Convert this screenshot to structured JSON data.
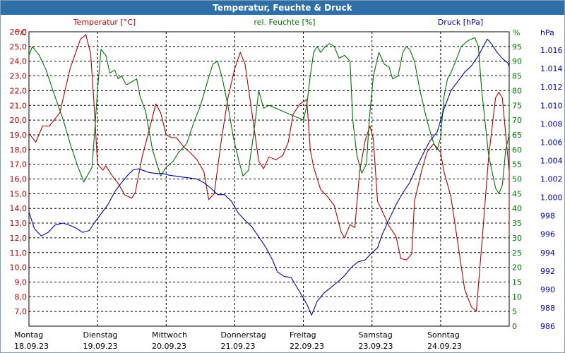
{
  "chart_data": {
    "type": "line",
    "title": "Temperatur, Feuchte & Druck",
    "series_labels": {
      "temperature": "Temperatur [°C]",
      "humidity": "rel. Feuchte [%]",
      "pressure": "Druck [hPa]"
    },
    "units": {
      "left": "°C",
      "mid": "%",
      "right": "hPa"
    },
    "colors": {
      "temperature": "#b00000",
      "humidity": "#007000",
      "pressure": "#0000a0",
      "grid": "#000000",
      "title_bar": "#2f6fa8"
    },
    "grid": true,
    "x_range": [
      0,
      7
    ],
    "x_labels": [
      {
        "day": "Montag",
        "date": "18.09.23"
      },
      {
        "day": "Dienstag",
        "date": "19.09.23"
      },
      {
        "day": "Mittwoch",
        "date": "20.09.23"
      },
      {
        "day": "Donnerstag",
        "date": "21.09.23"
      },
      {
        "day": "Freitag",
        "date": "22.09.23"
      },
      {
        "day": "Samstag",
        "date": "23.09.23"
      },
      {
        "day": "Sonntag",
        "date": "24.09.23"
      }
    ],
    "axes": {
      "temperature": {
        "min": 6.0,
        "max": 26.0,
        "ticks": [
          "26,0",
          "25,0",
          "24,0",
          "23,0",
          "22,0",
          "21,0",
          "20,0",
          "19,0",
          "18,0",
          "17,0",
          "16,0",
          "15,0",
          "14,0",
          "13,0",
          "12,0",
          "11,0",
          "10,0",
          "9,0",
          "8,0",
          "7,0"
        ]
      },
      "humidity": {
        "min": 0,
        "max": 100,
        "ticks": [
          "95",
          "90",
          "85",
          "80",
          "75",
          "70",
          "65",
          "60",
          "55",
          "50",
          "45",
          "40",
          "35",
          "30",
          "25",
          "20",
          "15",
          "10",
          "5",
          "0"
        ]
      },
      "pressure": {
        "min": 986,
        "max": 1018,
        "ticks": [
          "1.016",
          "1.014",
          "1.012",
          "1.010",
          "1.008",
          "1.006",
          "1.004",
          "1.002",
          "1.000",
          "998",
          "996",
          "994",
          "992",
          "990",
          "988",
          "986"
        ]
      }
    },
    "series": [
      {
        "name": "Temperatur [°C]",
        "axis": "temperature",
        "points": [
          [
            0.0,
            19.1
          ],
          [
            0.1,
            18.5
          ],
          [
            0.2,
            19.6
          ],
          [
            0.3,
            19.6
          ],
          [
            0.45,
            20.5
          ],
          [
            0.6,
            23.5
          ],
          [
            0.75,
            25.5
          ],
          [
            0.83,
            25.8
          ],
          [
            0.9,
            24.5
          ],
          [
            0.95,
            21
          ],
          [
            1.0,
            17
          ],
          [
            1.08,
            16.6
          ],
          [
            1.12,
            16.9
          ],
          [
            1.2,
            16.3
          ],
          [
            1.3,
            15.7
          ],
          [
            1.4,
            14.9
          ],
          [
            1.5,
            14.7
          ],
          [
            1.55,
            15.1
          ],
          [
            1.65,
            17.5
          ],
          [
            1.75,
            19.3
          ],
          [
            1.85,
            21.1
          ],
          [
            1.92,
            20.5
          ],
          [
            2.0,
            19
          ],
          [
            2.08,
            18.8
          ],
          [
            2.15,
            18.8
          ],
          [
            2.25,
            18.2
          ],
          [
            2.35,
            17.8
          ],
          [
            2.45,
            17.3
          ],
          [
            2.55,
            16.5
          ],
          [
            2.62,
            14.6
          ],
          [
            2.7,
            15
          ],
          [
            2.8,
            18.5
          ],
          [
            2.9,
            21.5
          ],
          [
            3.0,
            23.5
          ],
          [
            3.08,
            24.6
          ],
          [
            3.15,
            23.8
          ],
          [
            3.25,
            20.5
          ],
          [
            3.35,
            17.2
          ],
          [
            3.42,
            16.7
          ],
          [
            3.5,
            17.5
          ],
          [
            3.6,
            17.3
          ],
          [
            3.7,
            17.6
          ],
          [
            3.78,
            18.5
          ],
          [
            3.85,
            20.4
          ],
          [
            3.95,
            21.1
          ],
          [
            4.05,
            21.4
          ],
          [
            4.1,
            18
          ],
          [
            4.15,
            16.8
          ],
          [
            4.25,
            15.3
          ],
          [
            4.35,
            14.8
          ],
          [
            4.45,
            14.2
          ],
          [
            4.55,
            12.4
          ],
          [
            4.6,
            12
          ],
          [
            4.68,
            12.9
          ],
          [
            4.75,
            12.7
          ],
          [
            4.82,
            16.5
          ],
          [
            4.9,
            18.6
          ],
          [
            4.97,
            19.6
          ],
          [
            5.02,
            18.7
          ],
          [
            5.08,
            14.5
          ],
          [
            5.15,
            13.8
          ],
          [
            5.25,
            12.8
          ],
          [
            5.35,
            12.1
          ],
          [
            5.42,
            10.6
          ],
          [
            5.5,
            10.5
          ],
          [
            5.58,
            10.9
          ],
          [
            5.62,
            14.5
          ],
          [
            5.72,
            16.5
          ],
          [
            5.8,
            17.8
          ],
          [
            5.9,
            18.4
          ],
          [
            6.0,
            17.8
          ],
          [
            6.05,
            16.5
          ],
          [
            6.15,
            14.8
          ],
          [
            6.25,
            11.7
          ],
          [
            6.35,
            8.5
          ],
          [
            6.45,
            7.3
          ],
          [
            6.52,
            7.0
          ],
          [
            6.6,
            11.5
          ],
          [
            6.7,
            17.5
          ],
          [
            6.8,
            21.5
          ],
          [
            6.85,
            21.9
          ],
          [
            6.9,
            21.5
          ],
          [
            6.95,
            19
          ],
          [
            7.0,
            16.5
          ],
          [
            7.05,
            15.5
          ],
          [
            7.12,
            14.2
          ],
          [
            7.2,
            12.2
          ]
        ]
      },
      {
        "name": "rel. Feuchte [%]",
        "axis": "humidity",
        "points": [
          [
            0.0,
            92
          ],
          [
            0.05,
            95
          ],
          [
            0.15,
            92
          ],
          [
            0.25,
            87
          ],
          [
            0.35,
            80
          ],
          [
            0.5,
            70
          ],
          [
            0.6,
            62
          ],
          [
            0.7,
            55
          ],
          [
            0.8,
            49
          ],
          [
            0.92,
            54
          ],
          [
            1.0,
            80
          ],
          [
            1.05,
            94
          ],
          [
            1.12,
            92
          ],
          [
            1.18,
            86
          ],
          [
            1.25,
            87
          ],
          [
            1.3,
            84
          ],
          [
            1.35,
            85
          ],
          [
            1.42,
            82
          ],
          [
            1.5,
            83
          ],
          [
            1.57,
            84
          ],
          [
            1.62,
            78
          ],
          [
            1.7,
            73
          ],
          [
            1.8,
            60
          ],
          [
            1.92,
            51
          ],
          [
            2.0,
            54
          ],
          [
            2.1,
            56
          ],
          [
            2.18,
            59
          ],
          [
            2.3,
            62
          ],
          [
            2.4,
            69
          ],
          [
            2.5,
            75
          ],
          [
            2.6,
            83
          ],
          [
            2.68,
            89
          ],
          [
            2.75,
            90
          ],
          [
            2.82,
            84
          ],
          [
            2.9,
            75
          ],
          [
            2.98,
            64
          ],
          [
            3.05,
            57
          ],
          [
            3.12,
            51
          ],
          [
            3.2,
            53
          ],
          [
            3.28,
            66
          ],
          [
            3.35,
            80
          ],
          [
            3.42,
            74
          ],
          [
            3.5,
            75
          ],
          [
            3.6,
            74
          ],
          [
            3.7,
            73
          ],
          [
            3.8,
            72
          ],
          [
            3.9,
            71
          ],
          [
            4.0,
            70
          ],
          [
            4.05,
            75
          ],
          [
            4.1,
            85
          ],
          [
            4.15,
            93
          ],
          [
            4.2,
            95
          ],
          [
            4.25,
            93
          ],
          [
            4.32,
            95
          ],
          [
            4.38,
            96
          ],
          [
            4.45,
            95
          ],
          [
            4.52,
            91
          ],
          [
            4.6,
            92
          ],
          [
            4.68,
            90
          ],
          [
            4.72,
            70
          ],
          [
            4.78,
            58
          ],
          [
            4.85,
            52
          ],
          [
            4.92,
            55
          ],
          [
            4.96,
            70
          ],
          [
            5.02,
            85
          ],
          [
            5.1,
            93
          ],
          [
            5.18,
            89
          ],
          [
            5.25,
            88
          ],
          [
            5.3,
            84
          ],
          [
            5.38,
            85
          ],
          [
            5.45,
            93
          ],
          [
            5.5,
            95
          ],
          [
            5.55,
            94
          ],
          [
            5.62,
            90
          ],
          [
            5.7,
            80
          ],
          [
            5.8,
            70
          ],
          [
            5.9,
            62
          ],
          [
            5.95,
            60
          ],
          [
            6.0,
            64
          ],
          [
            6.05,
            78
          ],
          [
            6.1,
            84
          ],
          [
            6.15,
            86
          ],
          [
            6.22,
            90
          ],
          [
            6.3,
            95
          ],
          [
            6.4,
            97
          ],
          [
            6.5,
            98
          ],
          [
            6.55,
            95
          ],
          [
            6.6,
            80
          ],
          [
            6.7,
            58
          ],
          [
            6.8,
            47
          ],
          [
            6.85,
            45
          ],
          [
            6.9,
            48
          ],
          [
            6.95,
            60
          ],
          [
            7.05,
            65
          ],
          [
            7.12,
            75
          ],
          [
            7.18,
            80
          ]
        ]
      },
      {
        "name": "Druck [hPa]",
        "axis": "pressure",
        "points": [
          [
            0.0,
            998.4
          ],
          [
            0.08,
            996.6
          ],
          [
            0.18,
            995.8
          ],
          [
            0.28,
            996.2
          ],
          [
            0.38,
            997
          ],
          [
            0.5,
            997.2
          ],
          [
            0.62,
            996.9
          ],
          [
            0.7,
            996.6
          ],
          [
            0.78,
            996.2
          ],
          [
            0.88,
            996.4
          ],
          [
            0.95,
            997.2
          ],
          [
            1.05,
            998.2
          ],
          [
            1.15,
            999.2
          ],
          [
            1.25,
            1000.6
          ],
          [
            1.35,
            1001.6
          ],
          [
            1.45,
            1002.5
          ],
          [
            1.52,
            1003
          ],
          [
            1.6,
            1003.1
          ],
          [
            1.68,
            1002.9
          ],
          [
            1.75,
            1002.7
          ],
          [
            1.85,
            1002.6
          ],
          [
            1.95,
            1002.6
          ],
          [
            2.05,
            1002.4
          ],
          [
            2.15,
            1002.3
          ],
          [
            2.25,
            1002.2
          ],
          [
            2.35,
            1002.1
          ],
          [
            2.45,
            1002
          ],
          [
            2.55,
            1001.6
          ],
          [
            2.65,
            1001
          ],
          [
            2.75,
            1000.3
          ],
          [
            2.85,
            1000.3
          ],
          [
            2.95,
            999.6
          ],
          [
            3.05,
            998.3
          ],
          [
            3.15,
            997.5
          ],
          [
            3.25,
            996.8
          ],
          [
            3.35,
            995.7
          ],
          [
            3.45,
            994.6
          ],
          [
            3.55,
            993.2
          ],
          [
            3.62,
            991.9
          ],
          [
            3.72,
            991.4
          ],
          [
            3.82,
            991.3
          ],
          [
            3.9,
            990.3
          ],
          [
            3.98,
            989.3
          ],
          [
            4.05,
            988.4
          ],
          [
            4.12,
            987.2
          ],
          [
            4.2,
            988.7
          ],
          [
            4.3,
            989.6
          ],
          [
            4.4,
            990.2
          ],
          [
            4.5,
            990.8
          ],
          [
            4.6,
            991.5
          ],
          [
            4.7,
            992.4
          ],
          [
            4.8,
            993
          ],
          [
            4.9,
            993.2
          ],
          [
            5.0,
            994
          ],
          [
            5.08,
            994.5
          ],
          [
            5.15,
            996
          ],
          [
            5.25,
            997.6
          ],
          [
            5.35,
            999.2
          ],
          [
            5.45,
            1000.5
          ],
          [
            5.55,
            1001.6
          ],
          [
            5.65,
            1003.3
          ],
          [
            5.75,
            1004.8
          ],
          [
            5.85,
            1006.2
          ],
          [
            5.95,
            1007.1
          ],
          [
            6.05,
            1009.6
          ],
          [
            6.15,
            1011.6
          ],
          [
            6.25,
            1012.6
          ],
          [
            6.35,
            1013.6
          ],
          [
            6.45,
            1014.3
          ],
          [
            6.55,
            1015.4
          ],
          [
            6.63,
            1016.5
          ],
          [
            6.68,
            1017.2
          ],
          [
            6.75,
            1016.6
          ],
          [
            6.82,
            1015.8
          ],
          [
            6.9,
            1015.1
          ],
          [
            6.98,
            1014.6
          ],
          [
            7.05,
            1014.2
          ],
          [
            7.12,
            1014.3
          ],
          [
            7.18,
            1013.9
          ]
        ]
      }
    ]
  }
}
